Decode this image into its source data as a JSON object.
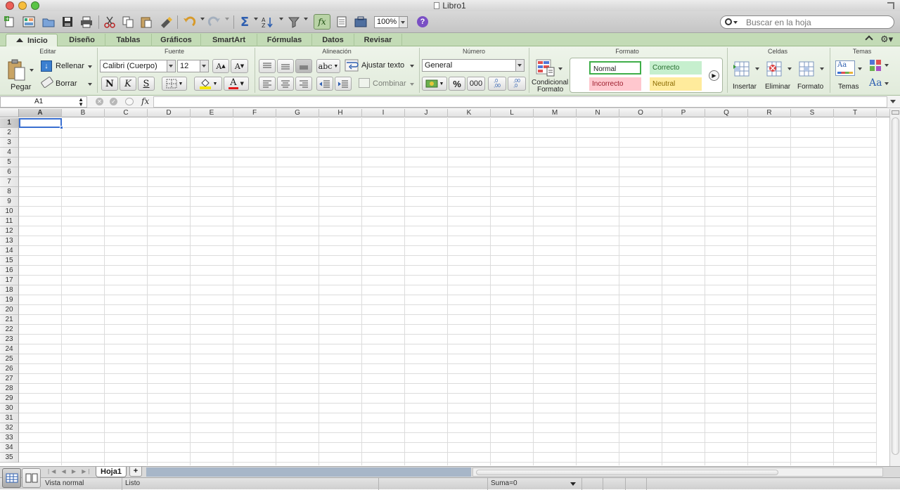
{
  "window": {
    "title": "Libro1"
  },
  "toolbar": {
    "zoom": "100%",
    "search_placeholder": "Buscar en la hoja"
  },
  "tabs": [
    "Inicio",
    "Diseño",
    "Tablas",
    "Gráficos",
    "SmartArt",
    "Fórmulas",
    "Datos",
    "Revisar"
  ],
  "ribbon": {
    "groups": {
      "editar": "Editar",
      "fuente": "Fuente",
      "alineacion": "Alineación",
      "numero": "Número",
      "formato": "Formato",
      "celdas": "Celdas",
      "temas": "Temas"
    },
    "editar": {
      "pegar": "Pegar",
      "rellenar": "Rellenar",
      "borrar": "Borrar"
    },
    "fuente": {
      "font": "Calibri (Cuerpo)",
      "size": "12",
      "bold": "N",
      "italic": "K",
      "underline": "S",
      "grow": "A",
      "shrink": "A",
      "color_a": "A"
    },
    "alineacion": {
      "abc": "abc",
      "ajustar": "Ajustar texto",
      "combinar": "Combinar"
    },
    "numero": {
      "format": "General",
      "percent": "%",
      "thousands": "000",
      "dec_inc": ",0\n,00",
      "dec_dec": ",00\n,0"
    },
    "formato": {
      "condicional_1": "Condicional",
      "condicional_2": "Formato",
      "styles": {
        "normal": "Normal",
        "correcto": "Correcto",
        "incorrecto": "Incorrecto",
        "neutral": "Neutral"
      }
    },
    "celdas": {
      "insertar": "Insertar",
      "eliminar": "Eliminar",
      "formato": "Formato"
    },
    "temas": {
      "temas": "Temas",
      "aa": "Aa"
    }
  },
  "formula_bar": {
    "name_box": "A1",
    "fx": "fx",
    "value": ""
  },
  "grid": {
    "columns": [
      "A",
      "B",
      "C",
      "D",
      "E",
      "F",
      "G",
      "H",
      "I",
      "J",
      "K",
      "L",
      "M",
      "N",
      "O",
      "P",
      "Q",
      "R",
      "S",
      "T"
    ],
    "rows": [
      "1",
      "2",
      "3",
      "4",
      "5",
      "6",
      "7",
      "8",
      "9",
      "10",
      "11",
      "12",
      "13",
      "14",
      "15",
      "16",
      "17",
      "18",
      "19",
      "20",
      "21",
      "22",
      "23",
      "24",
      "25",
      "26",
      "27",
      "28",
      "29",
      "30",
      "31",
      "32",
      "33",
      "34",
      "35"
    ],
    "selected_cell": "A1"
  },
  "sheets": {
    "active": "Hoja1",
    "add": "+"
  },
  "status": {
    "view": "Vista normal",
    "state": "Listo",
    "sum": "Suma=0"
  },
  "colors": {
    "tab_bar": "#c3dbb6",
    "ribbon": "#e6efe1",
    "selection": "#3a6fd0",
    "correcto": "#c6efce",
    "incorrecto": "#ffc7ce",
    "neutral": "#ffeb9c",
    "normal_border": "#3fae49"
  }
}
